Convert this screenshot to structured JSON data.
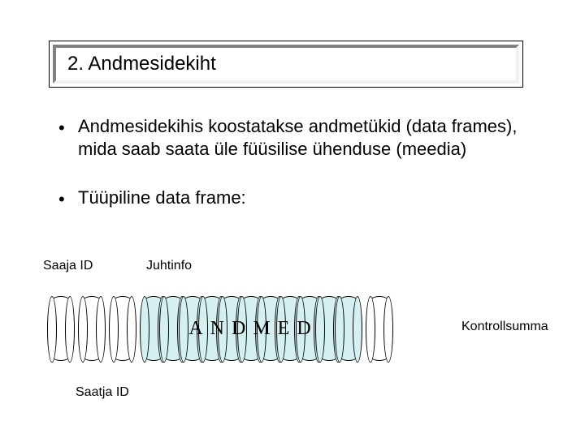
{
  "title": "2. Andmesidekiht",
  "bullets": [
    "Andmesidekihis koostatakse andmetükid (data frames), mida saab saata üle füüsilise ühenduse (meedia)",
    "Tüüpiline data frame:"
  ],
  "labels": {
    "saaja": "Saaja ID",
    "juhtinfo": "Juhtinfo",
    "saatja": "Saatja ID",
    "kontrollsumma": "Kontrollsumma"
  },
  "data_text": "ANDMED"
}
